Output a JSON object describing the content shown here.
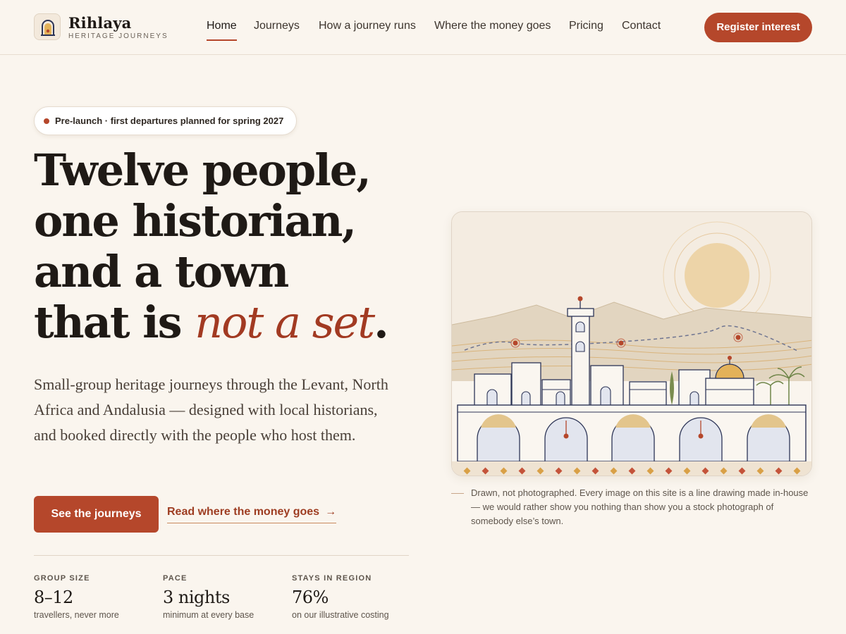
{
  "brand": {
    "name": "Rihlaya",
    "tagline": "Heritage Journeys"
  },
  "nav": {
    "items": [
      {
        "label": "Home",
        "active": true
      },
      {
        "label": "Journeys",
        "active": false
      },
      {
        "label": "How a journey runs",
        "active": false
      },
      {
        "label": "Where the money goes",
        "active": false
      },
      {
        "label": "Pricing",
        "active": false
      },
      {
        "label": "Contact",
        "active": false
      }
    ],
    "cta_label": "Register interest"
  },
  "hero": {
    "badge": "Pre-launch · first departures planned for spring 2027",
    "title_lines": [
      "Twelve people,",
      "one historian,",
      "and a town",
      "that is "
    ],
    "title_accent": "not a set",
    "title_end": ".",
    "subtitle": "Small-group heritage journeys through the Levant, North Africa and Andalusia — designed with local historians, and booked directly with the people who host them.",
    "primary_button": "See the journeys",
    "secondary_link": "Read where the money goes",
    "secondary_arrow": "→"
  },
  "stats": [
    {
      "label": "Group size",
      "value": "8–12",
      "caption": "travellers, never more"
    },
    {
      "label": "Pace",
      "value": "3 nights",
      "caption": "minimum at every base"
    },
    {
      "label": "Stays in region",
      "value": "76%",
      "caption": "on our illustrative costing"
    }
  ],
  "illustration": {
    "caption": "Drawn, not photographed. Every image on this site is a line drawing made in-house — we would rather show you nothing than show you a stock photograph of somebody else’s town."
  },
  "colors": {
    "background": "#faf5ee",
    "accent": "#b5472b",
    "accent_dark": "#a23a22",
    "ink": "#1f1a16"
  }
}
